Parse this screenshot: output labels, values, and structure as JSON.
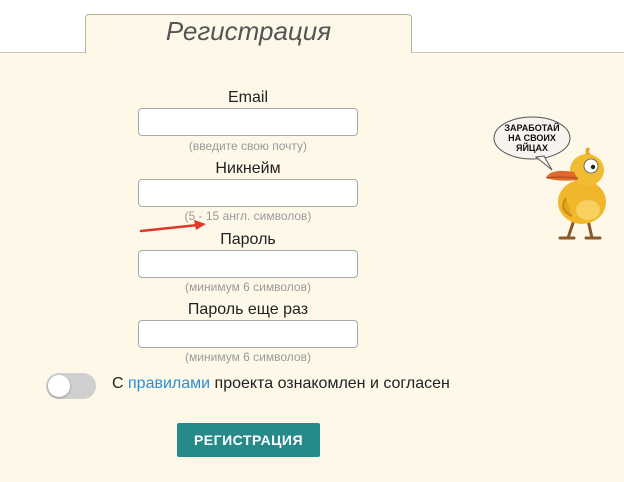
{
  "tab": {
    "title": "Регистрация"
  },
  "fields": [
    {
      "label": "Email",
      "value": "",
      "placeholder": "",
      "hint": "(введите свою почту)"
    },
    {
      "label": "Никнейм",
      "value": "",
      "placeholder": "",
      "hint": "(5 - 15 англ. символов)"
    },
    {
      "label": "Пароль",
      "value": "",
      "placeholder": "",
      "hint": "(минимум 6 символов)"
    },
    {
      "label": "Пароль еще раз",
      "value": "",
      "placeholder": "",
      "hint": "(минимум 6 символов)"
    }
  ],
  "agreement": {
    "prefix": "С",
    "link": "правилами",
    "suffix": "проекта ознакомлен и согласен",
    "checked": false
  },
  "submit_label": "РЕГИСТРАЦИЯ",
  "mascot": {
    "speech_line1": "ЗАРАБОТАЙ",
    "speech_line2": "НА СВОИХ",
    "speech_line3": "ЯЙЦАХ"
  },
  "colors": {
    "panel": "#fdf8e8",
    "submit": "#26898a",
    "link": "#2b8fd6",
    "hint": "#9a9a9a",
    "arrow": "#e0382b"
  }
}
